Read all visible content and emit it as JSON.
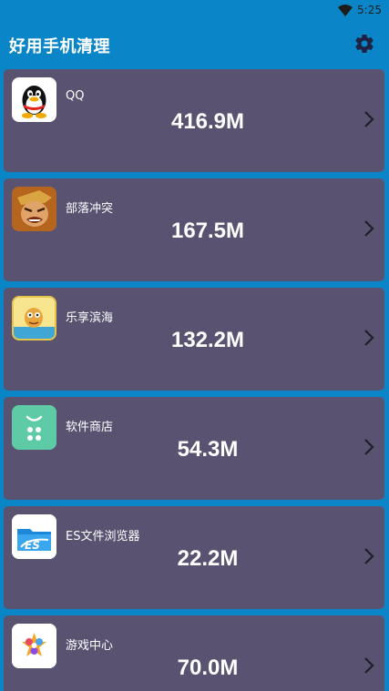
{
  "status_bar": {
    "time": "5:25"
  },
  "app_bar": {
    "title": "好用手机清理",
    "settings_icon": "gear-icon"
  },
  "apps": [
    {
      "name": "QQ",
      "size": "416.9M",
      "icon": "qq-penguin-icon"
    },
    {
      "name": "部落冲突",
      "size": "167.5M",
      "icon": "clash-of-clans-icon"
    },
    {
      "name": "乐享滨海",
      "size": "132.2M",
      "icon": "lexiang-binhai-icon"
    },
    {
      "name": "软件商店",
      "size": "54.3M",
      "icon": "app-store-icon"
    },
    {
      "name": "ES文件浏览器",
      "size": "22.2M",
      "icon": "es-file-explorer-icon"
    },
    {
      "name": "游戏中心",
      "size": "70.0M",
      "icon": "game-center-icon"
    }
  ],
  "colors": {
    "primary": "#0a86c8",
    "card": "#595371",
    "text": "#ffffff"
  }
}
